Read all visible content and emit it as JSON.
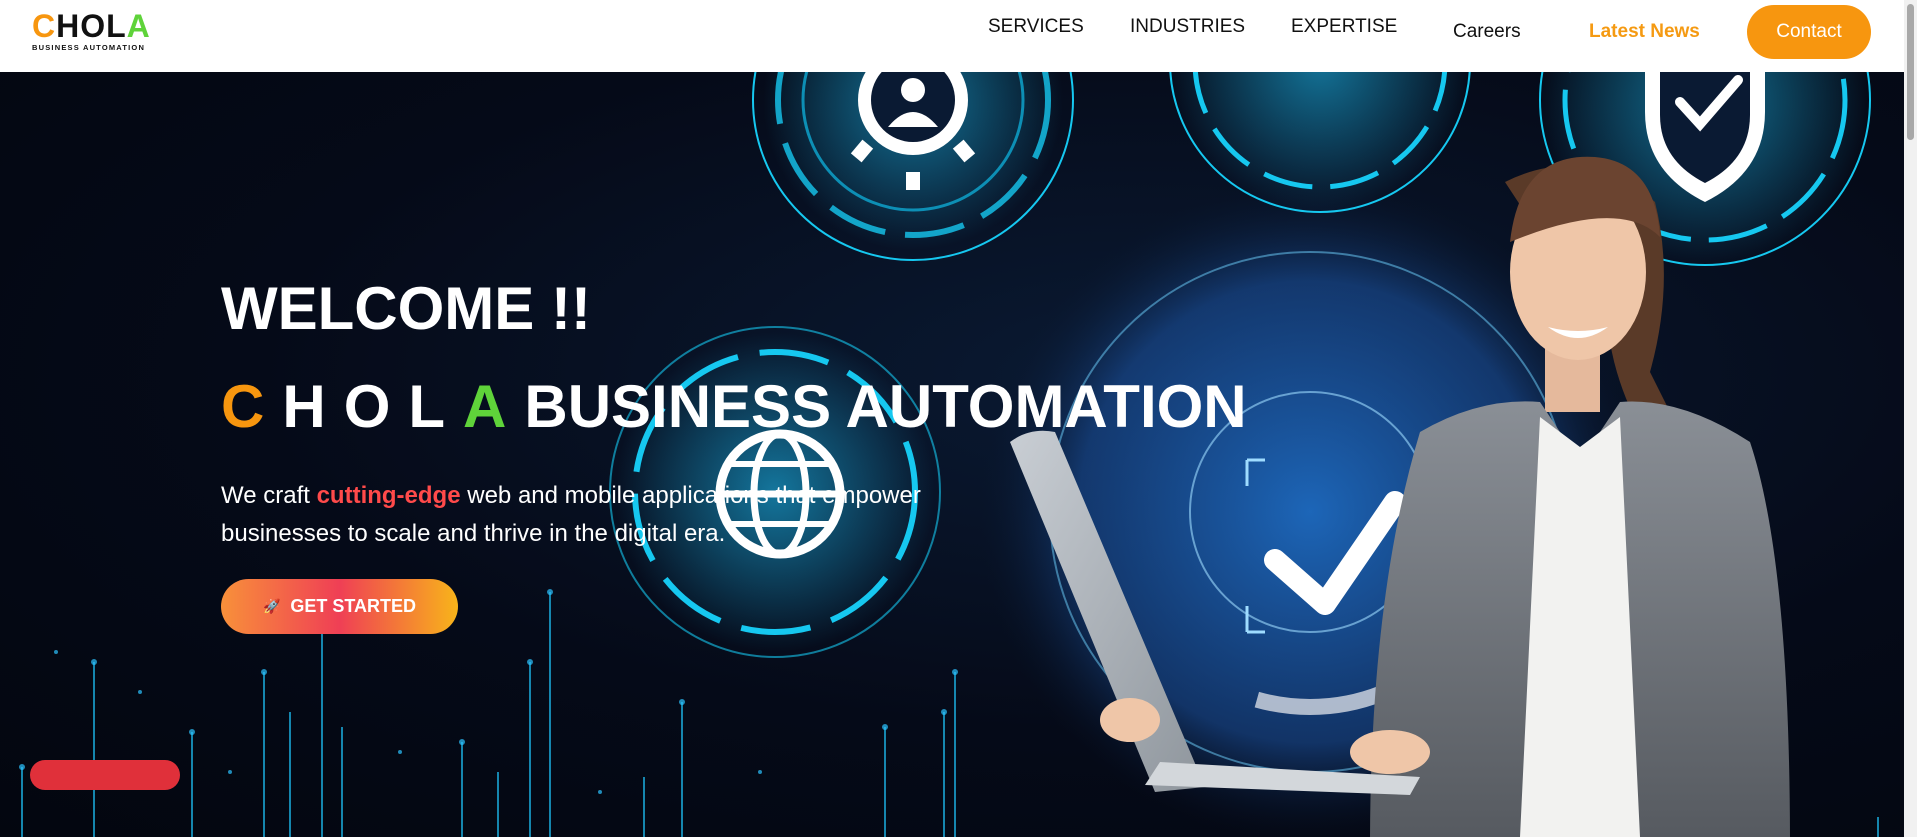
{
  "header": {
    "logo": {
      "letters": [
        "C",
        "H",
        "O",
        "L",
        "A"
      ],
      "subtitle": "BUSINESS AUTOMATION"
    },
    "nav": {
      "services": "SERVICES",
      "industries": "INDUSTRIES",
      "expertise": "EXPERTISE",
      "careers": "Careers",
      "latest_news": "Latest News",
      "contact": "Contact"
    }
  },
  "hero": {
    "welcome": "WELCOME !!",
    "brand_letters": [
      "C",
      "H",
      "O",
      "L",
      "A"
    ],
    "brand_rest": "BUSINESS AUTOMATION",
    "tagline_before": "We craft ",
    "tagline_highlight": "cutting-edge",
    "tagline_after": " web and mobile applications that empower businesses to scale and thrive in the digital era.",
    "cta_icon": "rocket-icon",
    "cta_label": "GET STARTED"
  },
  "colors": {
    "accent_orange": "#f7960f",
    "accent_green": "#5fd33a",
    "highlight_red": "#ff4a4a",
    "hero_bg": "#050a18",
    "glow_cyan": "#16c8f0"
  },
  "icons": [
    "gear-person-icon",
    "shield-check-icon",
    "globe-icon",
    "checkmark-icon"
  ]
}
